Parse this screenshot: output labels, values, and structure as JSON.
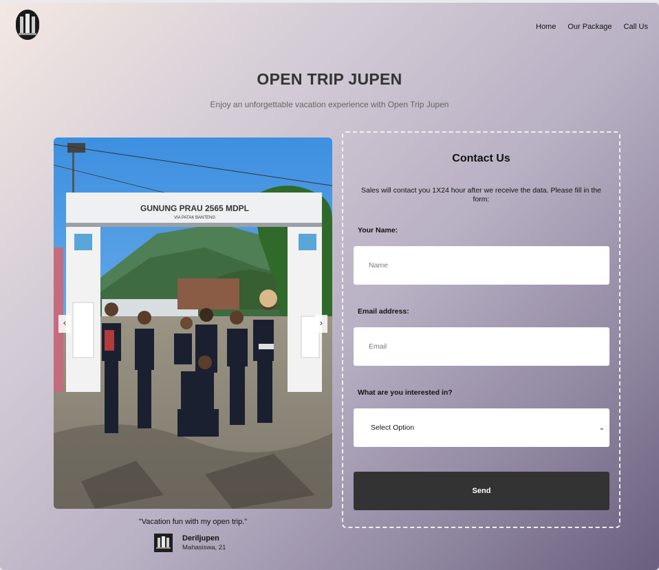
{
  "nav": {
    "items": [
      "Home",
      "Our Package",
      "Call Us"
    ]
  },
  "hero": {
    "title": "OPEN TRIP JUPEN",
    "subtitle": "Enjoy an unforgettable vacation experience with Open Trip Jupen"
  },
  "carousel": {
    "gate_line1": "GUNUNG PRAU 2565 MDPL",
    "gate_line2": "VIA PATAK BANTENG",
    "prev_label": "‹",
    "next_label": "›"
  },
  "testimonial": {
    "quote": "\"Vacation fun with my open trip.\"",
    "name": "Deriljupen",
    "role": "Mahasiswa, 21"
  },
  "form": {
    "title": "Contact Us",
    "description": "Sales will contact you 1X24 hour after we receive the data. Please fill in the form:",
    "name_label": "Your Name:",
    "name_placeholder": "Name",
    "email_label": "Email address:",
    "email_placeholder": "Email",
    "interest_label": "What are you interested in?",
    "interest_selected": "Select Option",
    "submit_label": "Send"
  },
  "icons": {
    "select_chevron": "chevron-down-icon",
    "logo": "logo-image",
    "avatar": "avatar-image"
  }
}
